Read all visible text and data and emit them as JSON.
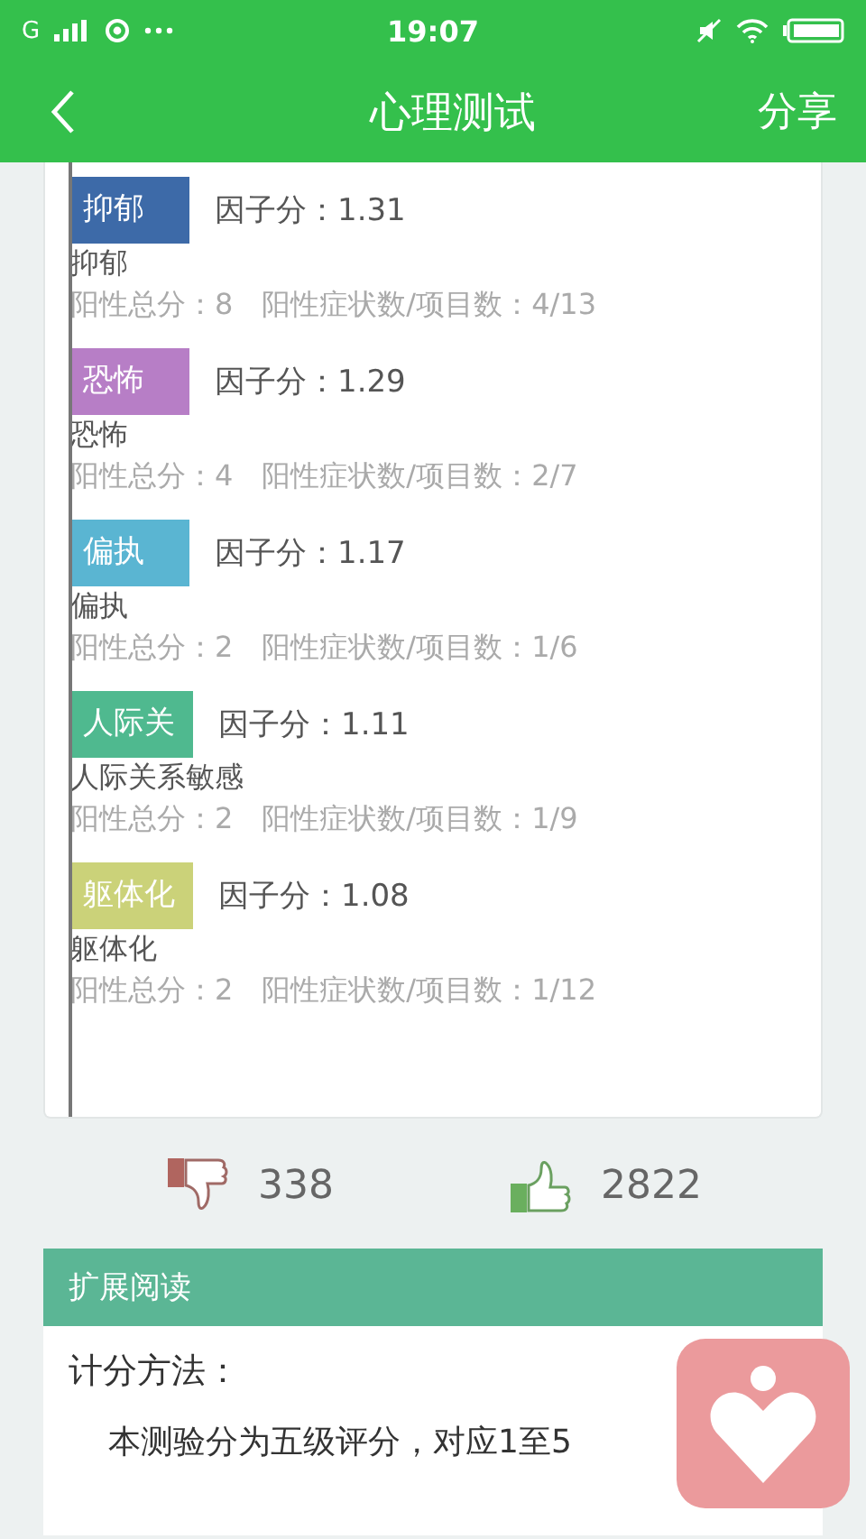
{
  "status_bar": {
    "carrier": "G",
    "time": "19:07"
  },
  "header": {
    "title": "心理测试",
    "share": "分享"
  },
  "factors": [
    {
      "tag": "抑郁",
      "color": "#3d6aa8",
      "score": "因子分：1.31",
      "name": "抑郁",
      "detail": "阳性总分：8　阳性症状数/项目数：4/13"
    },
    {
      "tag": "恐怖",
      "color": "#b77ec6",
      "score": "因子分：1.29",
      "name": "恐怖",
      "detail": "阳性总分：4　阳性症状数/项目数：2/7"
    },
    {
      "tag": "偏执",
      "color": "#5ab5d2",
      "score": "因子分：1.17",
      "name": "偏执",
      "detail": "阳性总分：2　阳性症状数/项目数：1/6"
    },
    {
      "tag": "人际关",
      "color": "#4fb98f",
      "score": "因子分：1.11",
      "name": "人际关系敏感",
      "detail": "阳性总分：2　阳性症状数/项目数：1/9"
    },
    {
      "tag": "躯体化",
      "color": "#cbd279",
      "score": "因子分：1.08",
      "name": "躯体化",
      "detail": "阳性总分：2　阳性症状数/项目数：1/12"
    }
  ],
  "votes": {
    "dislikes": "338",
    "likes": "2822"
  },
  "reading": {
    "title": "扩展阅读",
    "heading": "计分方法：",
    "text": "本测验分为五级评分，对应1至5"
  }
}
